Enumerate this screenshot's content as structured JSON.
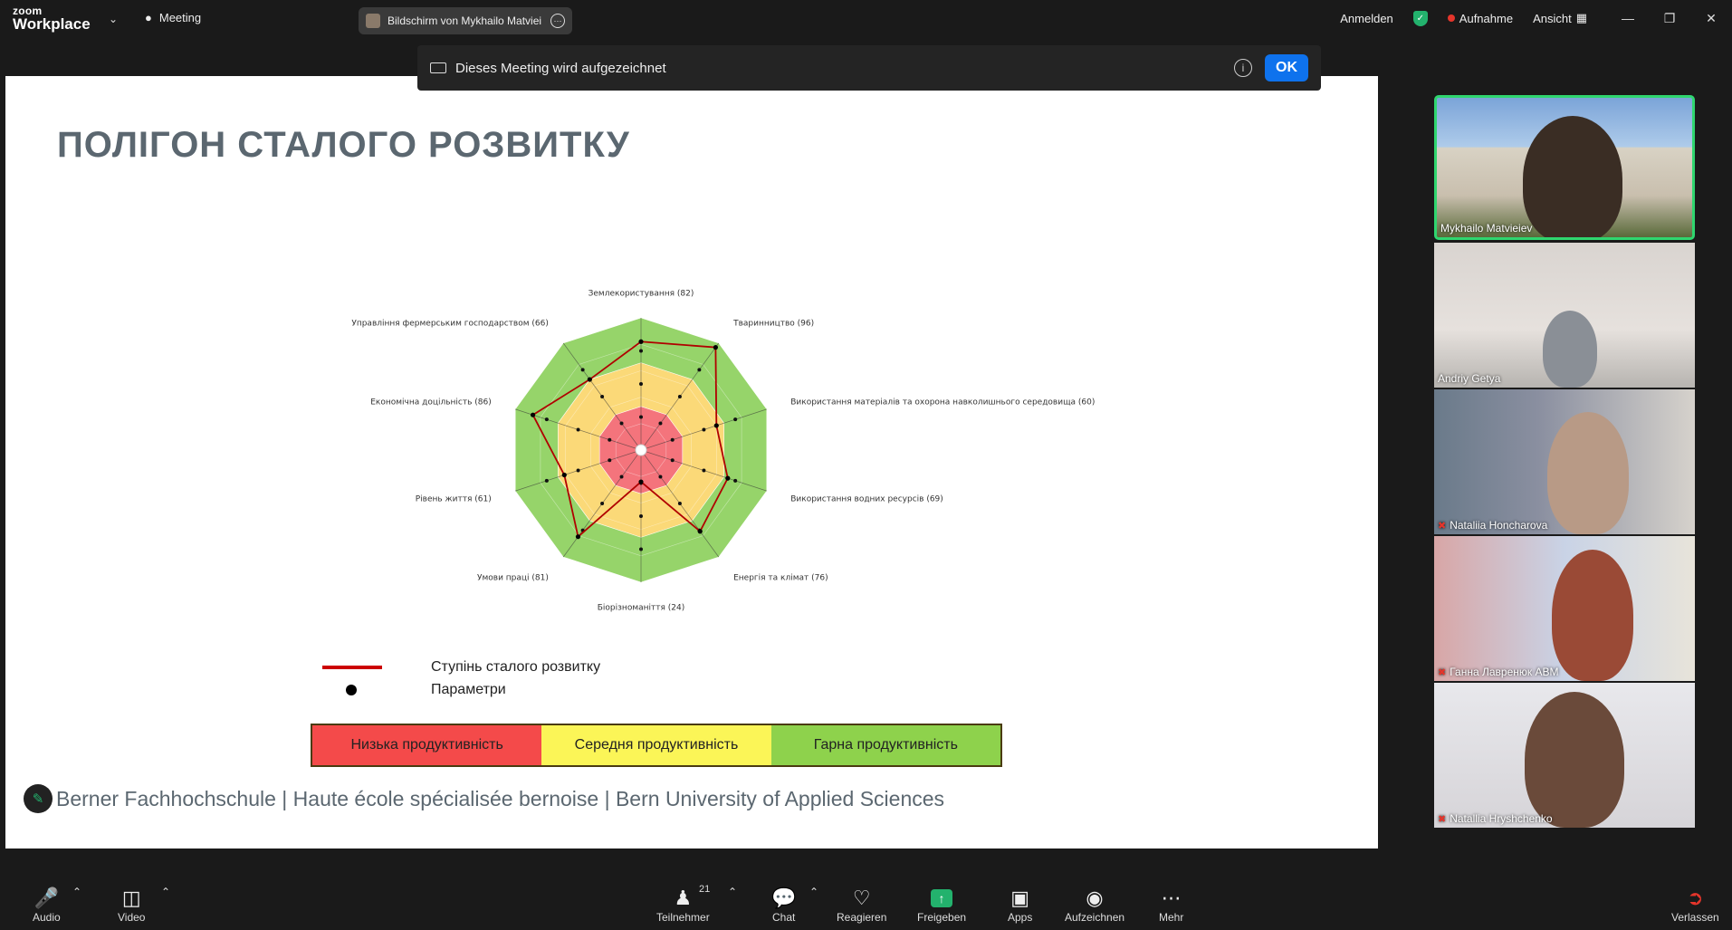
{
  "app": {
    "brand_line1": "zoom",
    "brand_line2": "Workplace",
    "meeting_tab": "Meeting",
    "share_title": "Bildschirm von Mykhailo Matviei",
    "signin": "Anmelden",
    "recording": "Aufnahme",
    "view": "Ansicht"
  },
  "notice": {
    "text": "Dieses Meeting wird aufgezeichnet",
    "ok": "OK"
  },
  "slide": {
    "title": "ПОЛІГОН СТАЛОГО РОЗВИТКУ",
    "legend_line": "Ступінь сталого розвитку",
    "legend_dot": "Параметри",
    "prod_low": "Низька продуктивність",
    "prod_mid": "Середня продуктивність",
    "prod_high": "Гарна продуктивність",
    "footer": "Berner Fachhochschule | Haute école spécialisée bernoise | Bern University of Applied Sciences"
  },
  "chart_data": {
    "type": "radar",
    "categories": [
      "Землекористування (82)",
      "Тваринництво (96)",
      "Використання матеріалів та охорона навколишнього середовища (60)",
      "Використання водних ресурсів (69)",
      "Енергія та клімат (76)",
      "Біорізноманіття (24)",
      "Умови праці (81)",
      "Рівень життя (61)",
      "Економічна доцільність (86)",
      "Управління фермерським господарством (66)"
    ],
    "values": [
      82,
      96,
      60,
      69,
      76,
      24,
      81,
      61,
      86,
      66
    ],
    "rlim": [
      0,
      100
    ],
    "bands": [
      {
        "range": [
          0,
          33
        ],
        "color": "#f4747c"
      },
      {
        "range": [
          33,
          66
        ],
        "color": "#fbd978"
      },
      {
        "range": [
          66,
          100
        ],
        "color": "#96d46a"
      }
    ],
    "series_color": "#b00000"
  },
  "participants": [
    {
      "name": "Mykhailo Matvieiev",
      "muted": false
    },
    {
      "name": "Andriy Getya",
      "muted": false
    },
    {
      "name": "Nataliia Honcharova",
      "muted": true
    },
    {
      "name": "Ганна Лавренюк ABM",
      "muted": true
    },
    {
      "name": "Natallia Hryshchenko",
      "muted": true
    }
  ],
  "toolbar": {
    "audio": "Audio",
    "video": "Video",
    "participants": "Teilnehmer",
    "participant_count": "21",
    "chat": "Chat",
    "react": "Reagieren",
    "share": "Freigeben",
    "apps": "Apps",
    "record": "Aufzeichnen",
    "more": "Mehr",
    "leave": "Verlassen"
  }
}
